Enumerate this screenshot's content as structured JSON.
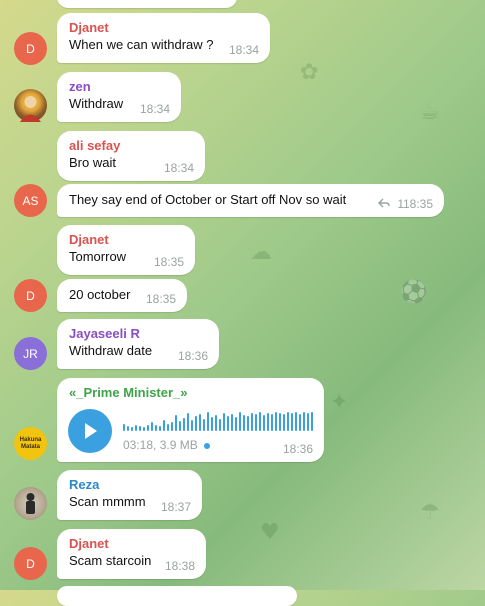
{
  "colors": {
    "name_red": "#d9534f",
    "name_purple": "#8a4ec4",
    "name_green": "#3fa34a",
    "name_blue": "#2b8ac6",
    "avatar_orange": "#e8674c",
    "avatar_purple": "#8b6fd8",
    "accent": "#3aa0e0",
    "time_gray": "#9aa3a0"
  },
  "messages": [
    {
      "sender": "Djanet",
      "text": "When we can withdraw ?",
      "time": "18:34",
      "avatar": "D"
    },
    {
      "sender": "zen",
      "text": "Withdraw",
      "time": "18:34"
    },
    {
      "sender": "ali sefay",
      "text": "Bro wait",
      "time": "18:34"
    },
    {
      "text": "They say end of October or Start off Nov so wait",
      "time": "18:35",
      "reply_count": "1",
      "avatar": "AS"
    },
    {
      "sender": "Djanet",
      "text": "Tomorrow",
      "time": "18:35"
    },
    {
      "text": "20 october",
      "time": "18:35",
      "avatar": "D"
    },
    {
      "sender": "Jayaseeli R",
      "text": "Withdraw date",
      "time": "18:36",
      "avatar": "JR"
    },
    {
      "sender": "«_Prime Minister_»",
      "voice": "03:18, 3.9 MB",
      "time": "18:36",
      "avatar_text": "Hakuna Matata"
    },
    {
      "sender": "Reza",
      "text": "Scan mmmm",
      "time": "18:37"
    },
    {
      "sender": "Djanet",
      "text": "Scam starcoin",
      "time": "18:38",
      "avatar": "D"
    }
  ],
  "waveform": [
    0.35,
    0.25,
    0.2,
    0.3,
    0.25,
    0.2,
    0.3,
    0.45,
    0.3,
    0.25,
    0.55,
    0.35,
    0.45,
    0.8,
    0.5,
    0.65,
    0.9,
    0.55,
    0.75,
    0.85,
    0.6,
    0.95,
    0.7,
    0.8,
    0.6,
    0.9,
    0.75,
    0.85,
    0.7,
    0.95,
    0.8,
    0.75,
    0.9,
    0.85,
    0.95,
    0.8,
    0.9,
    0.85,
    0.95,
    0.9,
    0.85,
    0.95,
    0.9,
    0.95,
    0.85,
    0.95,
    0.9,
    0.95
  ],
  "icons": [
    "play-icon",
    "reply-icon"
  ]
}
